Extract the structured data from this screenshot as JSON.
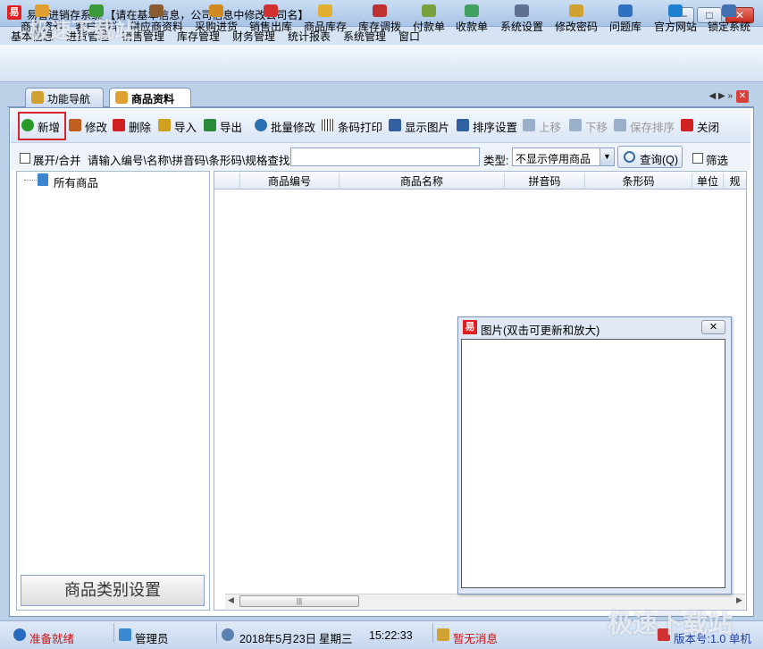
{
  "window": {
    "title": "易管进销存系统 【请在基本信息，公司信息中修改公司名】",
    "logo": "易"
  },
  "menu": [
    "基本信息",
    "进货管理",
    "销售管理",
    "库存管理",
    "财务管理",
    "统计报表",
    "系统管理",
    "窗口"
  ],
  "toolbar": [
    {
      "label": "商品资料",
      "icon": "goods-icon",
      "color": "#e0a030"
    },
    {
      "label": "客户资料",
      "icon": "customer-icon",
      "color": "#3a9a3a"
    },
    {
      "label": "供应商资料",
      "icon": "supplier-icon",
      "color": "#8a5a30"
    },
    {
      "label": "采购进货",
      "icon": "purchase-icon",
      "color": "#d08a20"
    },
    {
      "label": "销售出库",
      "icon": "sales-icon",
      "color": "#d03030"
    },
    {
      "label": "商品库存",
      "icon": "stock-icon",
      "color": "#e0b030"
    },
    {
      "label": "库存调拨",
      "icon": "transfer-icon",
      "color": "#c03030"
    },
    {
      "label": "付款单",
      "icon": "payment-icon",
      "color": "#7aa040"
    },
    {
      "label": "收款单",
      "icon": "receipt-icon",
      "color": "#40a060"
    },
    {
      "label": "系统设置",
      "icon": "settings-icon",
      "color": "#607090"
    },
    {
      "label": "修改密码",
      "icon": "password-icon",
      "color": "#d0a030"
    },
    {
      "label": "问题库",
      "icon": "help-icon",
      "color": "#3070c0"
    },
    {
      "label": "官方网站",
      "icon": "website-icon",
      "color": "#2080d0"
    },
    {
      "label": "锁定系统",
      "icon": "lock-icon",
      "color": "#4070b0"
    }
  ],
  "tabs": [
    {
      "label": "功能导航"
    },
    {
      "label": "商品资料"
    }
  ],
  "actions": [
    {
      "label": "新增",
      "icon": "add-icon",
      "color": "#2a9a2a",
      "disabled": false
    },
    {
      "label": "修改",
      "icon": "edit-icon",
      "color": "#c06020",
      "disabled": false
    },
    {
      "label": "删除",
      "icon": "delete-icon",
      "color": "#d02020",
      "disabled": false
    },
    {
      "label": "导入",
      "icon": "import-icon",
      "color": "#d0a020",
      "disabled": false
    },
    {
      "label": "导出",
      "icon": "export-icon",
      "color": "#2a8a3a",
      "disabled": false
    },
    {
      "label": "批量修改",
      "icon": "batch-edit-icon",
      "color": "#2a70b0",
      "disabled": false
    },
    {
      "label": "条码打印",
      "icon": "barcode-icon",
      "color": "#333333",
      "disabled": false
    },
    {
      "label": "显示图片",
      "icon": "image-icon",
      "color": "#3060a0",
      "disabled": false
    },
    {
      "label": "排序设置",
      "icon": "sort-icon",
      "color": "#3060a0",
      "disabled": false
    },
    {
      "label": "上移",
      "icon": "move-up-icon",
      "color": "#9ab0c8",
      "disabled": true
    },
    {
      "label": "下移",
      "icon": "move-down-icon",
      "color": "#9ab0c8",
      "disabled": true
    },
    {
      "label": "保存排序",
      "icon": "save-icon",
      "color": "#9ab0c8",
      "disabled": true
    },
    {
      "label": "关闭",
      "icon": "close-icon",
      "color": "#d02020",
      "disabled": false
    }
  ],
  "filter": {
    "expand_label": "展开/合并",
    "search_label": "请输入编号\\名称\\拼音码\\条形码\\规格查找:",
    "search_value": "",
    "type_label": "类型:",
    "type_value": "不显示停用商品",
    "query_label": "查询(Q)",
    "filter_label": "筛选"
  },
  "tree": {
    "root": "所有商品",
    "category_button": "商品类别设置"
  },
  "grid": {
    "columns": [
      "商品编号",
      "商品名称",
      "拼音码",
      "条形码",
      "单位",
      "规"
    ]
  },
  "image_window": {
    "title": "图片(双击可更新和放大)",
    "logo": "易"
  },
  "status": {
    "ready": "准备就绪",
    "user": "管理员",
    "date": "2018年5月23日",
    "weekday": "星期三",
    "time": "15:22:33",
    "message": "暂无消息",
    "version": "版本号:1.0 单机"
  },
  "watermark": "极速下载站"
}
